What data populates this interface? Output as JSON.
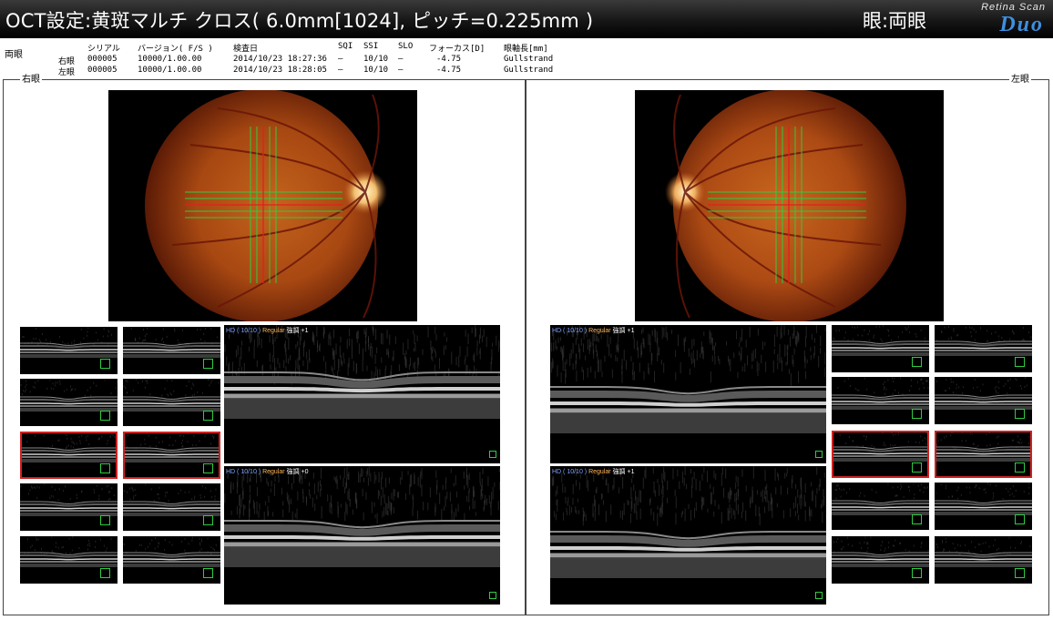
{
  "header": {
    "title": "OCT設定:黄斑マルチ クロス( 6.0mm[1024], ピッチ=0.225mm )",
    "eye_mode": "眼:両眼",
    "logo_sub": "Retina Scan",
    "logo_brand": "Duo"
  },
  "info": {
    "group_label": "両眼",
    "headers": {
      "serial": "シリアル",
      "version": "バージョン( F/S )",
      "date": "検査日",
      "sqi": "SQI",
      "ssi": "SSI",
      "slo": "SLO",
      "focus": "フォーカス[D]",
      "axial": "眼軸長[mm]"
    },
    "rows": [
      {
        "eye": "右眼",
        "serial": "000005",
        "version": "10000/1.00.00",
        "date": "2014/10/23 18:27:36",
        "sqi": "—",
        "ssi": "10/10",
        "slo": "—",
        "focus": "-4.75",
        "axial": "Gullstrand"
      },
      {
        "eye": "左眼",
        "serial": "000005",
        "version": "10000/1.00.00",
        "date": "2014/10/23 18:28:05",
        "sqi": "—",
        "ssi": "10/10",
        "slo": "—",
        "focus": "-4.75",
        "axial": "Gullstrand"
      }
    ]
  },
  "panels": {
    "right_eye": {
      "label": "右眼",
      "scans": [
        {
          "hd": "HD ( 10/10 )",
          "mode": "Regular",
          "enhance": "強調 +1"
        },
        {
          "hd": "HD ( 10/10 )",
          "mode": "Regular",
          "enhance": "強調 +0"
        }
      ]
    },
    "left_eye": {
      "label": "左眼",
      "scans": [
        {
          "hd": "HD ( 10/10 )",
          "mode": "Regular",
          "enhance": "強調 +1"
        },
        {
          "hd": "HD ( 10/10 )",
          "mode": "Regular",
          "enhance": "強調 +1"
        }
      ]
    }
  },
  "colors": {
    "selected_border": "#d02020",
    "scan_line": "#2ecc40",
    "hd_label": "#7fa3ff",
    "mode_label": "#ffb65a"
  }
}
